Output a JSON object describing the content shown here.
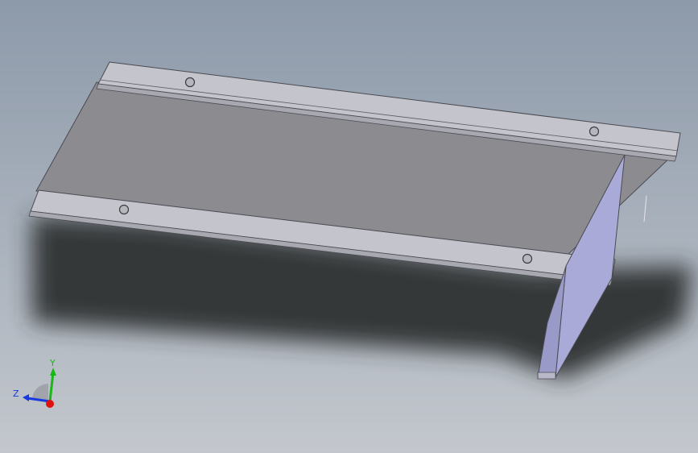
{
  "viewport": {
    "background_top": "#8d9aaa",
    "background_bottom": "#c3c7cd"
  },
  "part": {
    "face_color": "#8c8b90",
    "flange_color": "#c4c4cc",
    "web_color": "#aaaad8",
    "edge_color": "#4a4a52",
    "hole_color": "#b6b6bd",
    "shadow_color": "#2e3033"
  },
  "triad": {
    "x_color": "#e01010",
    "y_color": "#18b818",
    "z_color": "#1838e0",
    "y_label": "Y",
    "z_label": "Z"
  }
}
